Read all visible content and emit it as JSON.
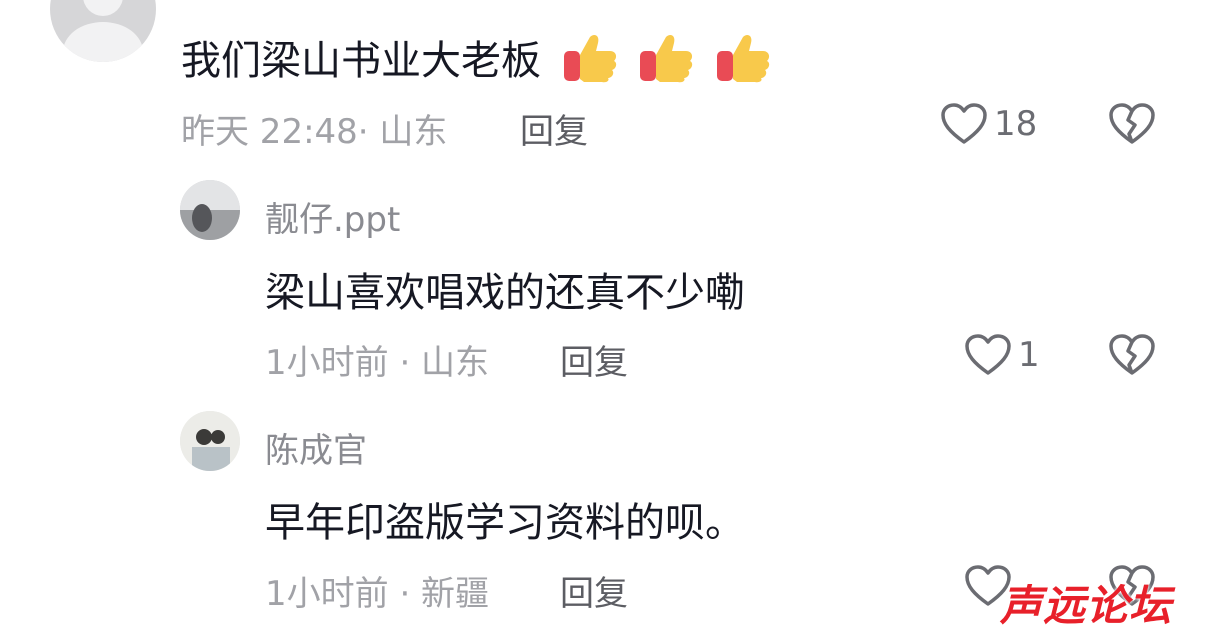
{
  "comment": {
    "text": "我们梁山书业大老板",
    "emoji": [
      "thumbs-up-emoji",
      "thumbs-up-emoji",
      "thumbs-up-emoji"
    ],
    "meta": "昨天 22:48· 山东",
    "reply_label": "回复",
    "like_count": "18"
  },
  "replies": [
    {
      "name": "靓仔.ppt",
      "text": "梁山喜欢唱戏的还真不少嘞",
      "meta": "1小时前 · 山东",
      "reply_label": "回复",
      "like_count": "1"
    },
    {
      "name": "陈成官",
      "text": "早年印盗版学习资料的呗。",
      "meta": "1小时前 · 新疆",
      "reply_label": "回复",
      "like_count": ""
    }
  ],
  "watermark": "声远论坛",
  "colors": {
    "text": "#161823",
    "meta": "#a1a2a7",
    "watermark": "#e8202a"
  }
}
